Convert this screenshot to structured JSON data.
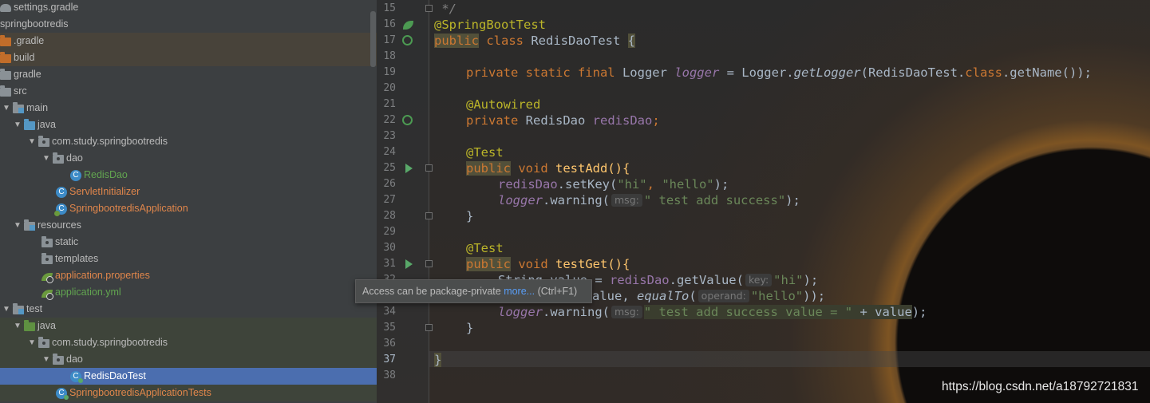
{
  "tree": {
    "items": [
      {
        "label": "settings.gradle",
        "icon": "gradle-file-icon",
        "color": "gray"
      },
      {
        "label": "springbootredis",
        "icon": "",
        "color": "gray"
      },
      {
        "label": ".gradle",
        "icon": "excluded-folder-icon",
        "color": "gray"
      },
      {
        "label": "build",
        "icon": "excluded-folder-icon",
        "color": "gray"
      },
      {
        "label": "gradle",
        "icon": "folder-icon",
        "color": "gray"
      },
      {
        "label": "src",
        "icon": "folder-icon",
        "color": "gray"
      },
      {
        "label": "main",
        "icon": "module-folder-icon",
        "color": "gray"
      },
      {
        "label": "java",
        "icon": "source-root-icon",
        "color": "gray"
      },
      {
        "label": "com.study.springbootredis",
        "icon": "package-icon",
        "color": "gray"
      },
      {
        "label": "dao",
        "icon": "package-icon",
        "color": "gray"
      },
      {
        "label": "RedisDao",
        "icon": "class-icon",
        "color": "green"
      },
      {
        "label": "ServletInitializer",
        "icon": "class-icon",
        "color": "orange"
      },
      {
        "label": "SpringbootredisApplication",
        "icon": "spring-boot-class-icon",
        "color": "orange"
      },
      {
        "label": "resources",
        "icon": "resources-folder-icon",
        "color": "gray"
      },
      {
        "label": "static",
        "icon": "package-icon",
        "color": "gray"
      },
      {
        "label": "templates",
        "icon": "package-icon",
        "color": "gray"
      },
      {
        "label": "application.properties",
        "icon": "spring-config-icon",
        "color": "orange"
      },
      {
        "label": "application.yml",
        "icon": "spring-config-icon",
        "color": "green"
      },
      {
        "label": "test",
        "icon": "module-folder-icon",
        "color": "gray"
      },
      {
        "label": "java",
        "icon": "test-root-icon",
        "color": "gray"
      },
      {
        "label": "com.study.springbootredis",
        "icon": "package-icon",
        "color": "gray"
      },
      {
        "label": "dao",
        "icon": "package-icon",
        "color": "gray"
      },
      {
        "label": "RedisDaoTest",
        "icon": "test-class-icon",
        "color": "white"
      },
      {
        "label": "SpringbootredisApplicationTests",
        "icon": "test-class-icon",
        "color": "orange"
      }
    ]
  },
  "editor": {
    "line_numbers": [
      "15",
      "16",
      "17",
      "18",
      "19",
      "20",
      "21",
      "22",
      "23",
      "24",
      "25",
      "26",
      "27",
      "28",
      "29",
      "30",
      "31",
      "32",
      "33",
      "34",
      "35",
      "36",
      "37",
      "38"
    ],
    "current_line": "37",
    "code": {
      "l15": " */",
      "l16_ann": "@SpringBootTest",
      "l17_kw1": "public",
      "l17_kw2": " class ",
      "l17_name": "RedisDaoTest ",
      "l17_brace": "{",
      "l19_kw": "private static final ",
      "l19_type": "Logger ",
      "l19_field": "logger",
      "l19_eq": " = Logger.",
      "l19_m": "getLogger",
      "l19_rest1": "(RedisDaoTest.",
      "l19_cls": "class",
      "l19_rest2": ".getName());",
      "l21_ann": "@Autowired",
      "l22_kw": "private ",
      "l22_type": "RedisDao ",
      "l22_field": "redisDao",
      "l22_semi": ";",
      "l24_ann": "@Test",
      "l25_kw1": "public",
      "l25_kw2": " void ",
      "l25_name": "testAdd(){",
      "l26_field": "redisDao",
      "l26_call": ".setKey(",
      "l26_s1": "\"hi\"",
      "l26_comma": ", ",
      "l26_s2": "\"hello\"",
      "l26_end": ");",
      "l27_field": "logger",
      "l27_call": ".warning(",
      "l27_hint": "msg:",
      "l27_str": "\" test add success\"",
      "l27_end": ");",
      "l28": "}",
      "l30_ann": "@Test",
      "l31_kw1": "public",
      "l31_kw2": " void ",
      "l31_name": "testGet(){",
      "l32_pre": "String value = ",
      "l32_field": "redisDao",
      "l32_call": ".getValue(",
      "l32_hint": "key:",
      "l32_str": "\"hi\"",
      "l32_end": ");",
      "l33_pre": "alue, ",
      "l33_m": "equalTo",
      "l33_paren": "(",
      "l33_hint": "operand:",
      "l33_str": "\"hello\"",
      "l33_end": "));",
      "l34_field": "logger",
      "l34_call": ".warning(",
      "l34_hint": "msg:",
      "l34_str": "\" test add success value = \"",
      "l34_plus": " + value",
      "l34_end": ");",
      "l35": "}",
      "l37": "}"
    }
  },
  "tooltip": {
    "text": "Access can be package-private ",
    "link": "more...",
    "shortcut": " (Ctrl+F1)"
  },
  "background_logo": "aura",
  "watermark": "https://blog.csdn.net/a18792721831",
  "colors": {
    "keyword": "#cc7832",
    "annotation": "#bbb529",
    "string": "#6a8759",
    "field": "#9876aa",
    "method": "#ffc66d",
    "selection": "#4b6eaf"
  }
}
